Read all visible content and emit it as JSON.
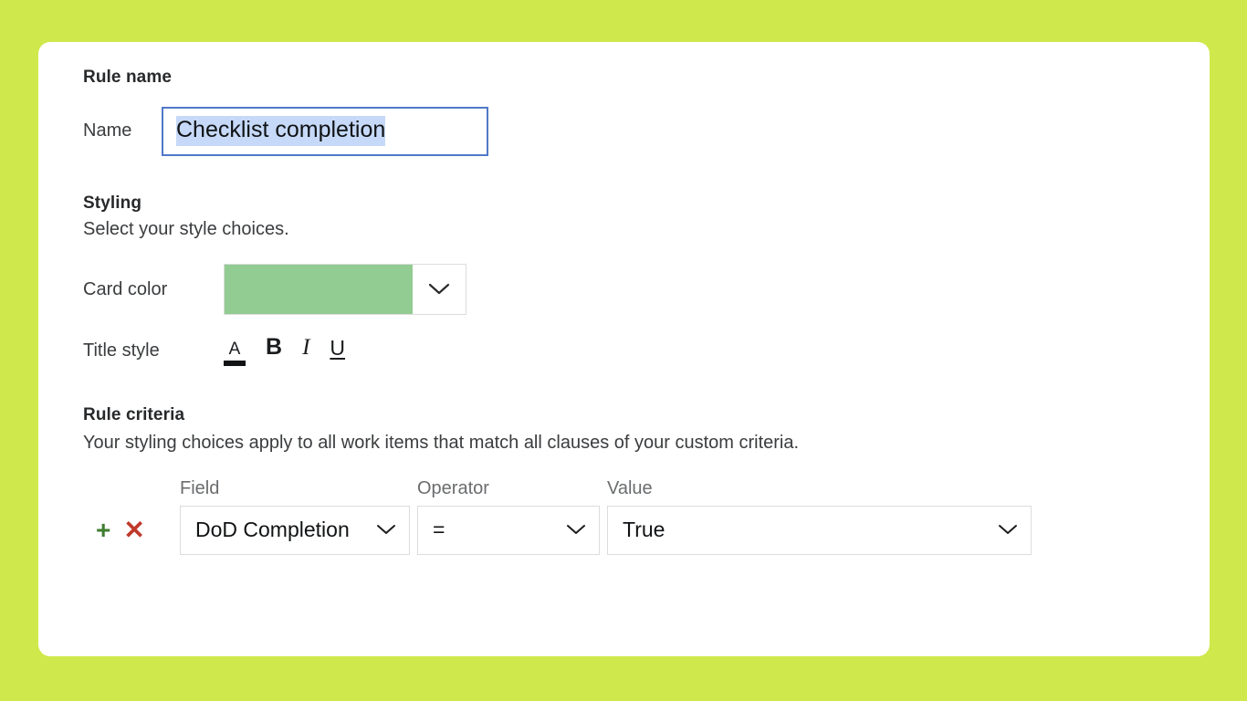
{
  "page": {
    "background_color": "#cfe94d",
    "card_background": "#ffffff"
  },
  "rule_name": {
    "heading": "Rule name",
    "name_label": "Name",
    "name_value": "Checklist completion",
    "name_selected": true,
    "selection_color": "#c6d9f8",
    "focus_border_color": "#5078c8"
  },
  "styling": {
    "heading": "Styling",
    "description": "Select your style choices.",
    "card_color_label": "Card color",
    "card_color_value": "#92cc92",
    "card_color_caret": "chevron-down-icon",
    "title_style_label": "Title style",
    "title_style_buttons": [
      {
        "id": "text-color",
        "glyph": "A",
        "active": true,
        "underline_color": "#111315"
      },
      {
        "id": "bold",
        "glyph": "B",
        "active": false
      },
      {
        "id": "italic",
        "glyph": "I",
        "active": false
      },
      {
        "id": "underline",
        "glyph": "U",
        "active": false
      }
    ]
  },
  "rule_criteria": {
    "heading": "Rule criteria",
    "description": "Your styling choices apply to all work items that match all clauses of your custom criteria.",
    "columns": {
      "field": "Field",
      "operator": "Operator",
      "value": "Value"
    },
    "actions": {
      "add_glyph": "+",
      "add_color": "#3f7d2f",
      "remove_glyph": "✕",
      "remove_color": "#c0392b"
    },
    "rows": [
      {
        "field": "DoD Completion",
        "operator": "=",
        "value": "True"
      }
    ]
  }
}
